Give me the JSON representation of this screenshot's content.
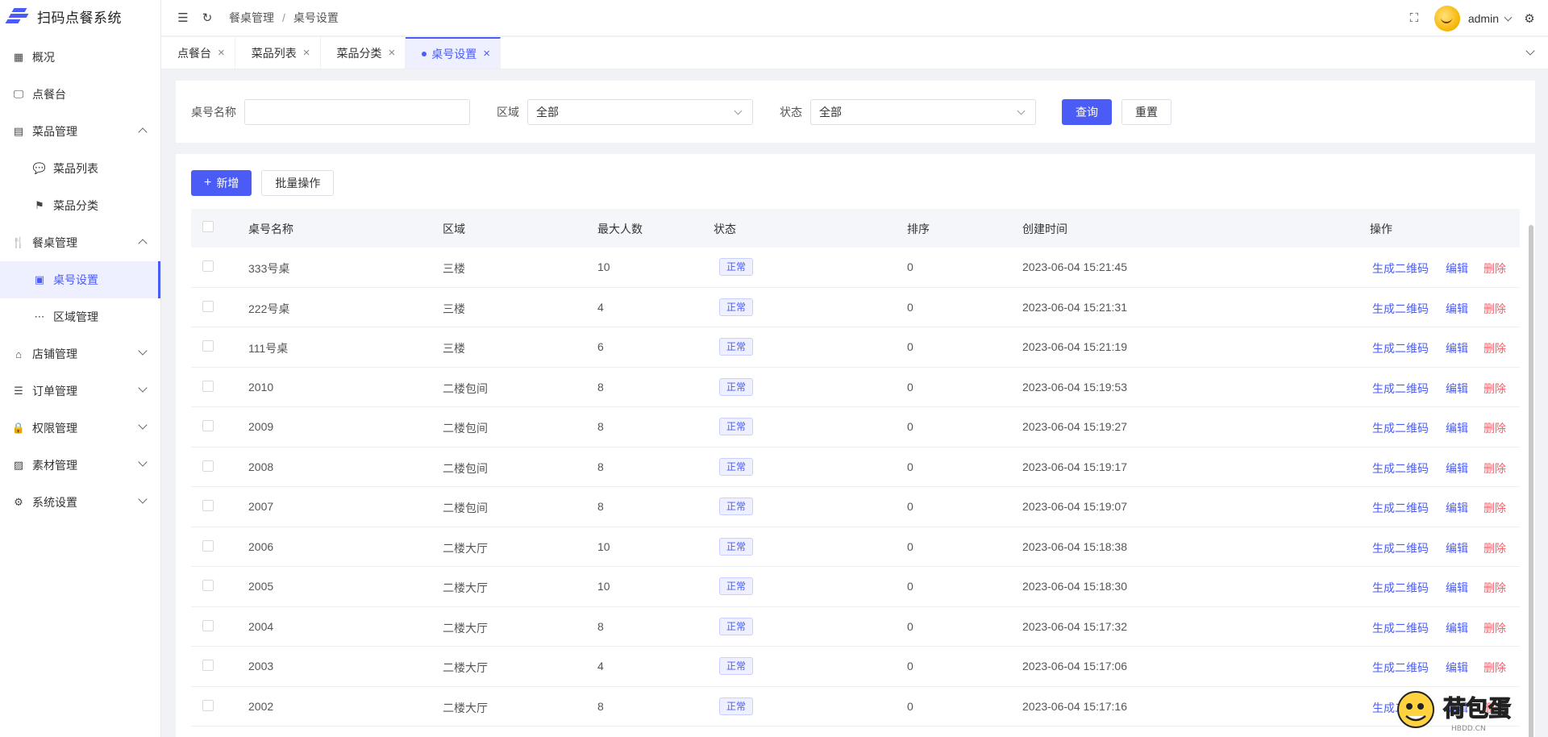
{
  "app": {
    "title": "扫码点餐系统"
  },
  "sidebar": {
    "items": [
      {
        "label": "概况",
        "icon": "dashboard-icon",
        "level": 0
      },
      {
        "label": "点餐台",
        "icon": "monitor-icon",
        "level": 0
      },
      {
        "label": "菜品管理",
        "icon": "message-icon",
        "level": 0,
        "expanded": true
      },
      {
        "label": "菜品列表",
        "icon": "chat-icon",
        "level": 1
      },
      {
        "label": "菜品分类",
        "icon": "bookmark-icon",
        "level": 1
      },
      {
        "label": "餐桌管理",
        "icon": "utensils-icon",
        "level": 0,
        "expanded": true
      },
      {
        "label": "桌号设置",
        "icon": "table-icon",
        "level": 1,
        "active": true
      },
      {
        "label": "区域管理",
        "icon": "dots-icon",
        "level": 1
      },
      {
        "label": "店铺管理",
        "icon": "store-icon",
        "level": 0,
        "expanded": false
      },
      {
        "label": "订单管理",
        "icon": "order-icon",
        "level": 0,
        "expanded": false
      },
      {
        "label": "权限管理",
        "icon": "lock-icon",
        "level": 0,
        "expanded": false
      },
      {
        "label": "素材管理",
        "icon": "image-icon",
        "level": 0,
        "expanded": false
      },
      {
        "label": "系统设置",
        "icon": "gear-icon",
        "level": 0,
        "expanded": false
      }
    ]
  },
  "header": {
    "breadcrumb": [
      "餐桌管理",
      "桌号设置"
    ],
    "user": "admin"
  },
  "tabs": [
    {
      "label": "点餐台",
      "active": false
    },
    {
      "label": "菜品列表",
      "active": false
    },
    {
      "label": "菜品分类",
      "active": false
    },
    {
      "label": "桌号设置",
      "active": true
    }
  ],
  "filters": {
    "name_label": "桌号名称",
    "name_value": "",
    "area_label": "区域",
    "area_value": "全部",
    "status_label": "状态",
    "status_value": "全部",
    "search_button": "查询",
    "reset_button": "重置"
  },
  "toolbar": {
    "add_button": "新增",
    "batch_button": "批量操作"
  },
  "table": {
    "columns": [
      "桌号名称",
      "区域",
      "最大人数",
      "状态",
      "排序",
      "创建时间",
      "操作"
    ],
    "actions": {
      "qr": "生成二维码",
      "edit": "编辑",
      "delete": "删除"
    },
    "rows": [
      {
        "name": "333号桌",
        "area": "三楼",
        "max": "10",
        "status": "正常",
        "sort": "0",
        "created": "2023-06-04 15:21:45"
      },
      {
        "name": "222号桌",
        "area": "三楼",
        "max": "4",
        "status": "正常",
        "sort": "0",
        "created": "2023-06-04 15:21:31"
      },
      {
        "name": "111号桌",
        "area": "三楼",
        "max": "6",
        "status": "正常",
        "sort": "0",
        "created": "2023-06-04 15:21:19"
      },
      {
        "name": "2010",
        "area": "二楼包间",
        "max": "8",
        "status": "正常",
        "sort": "0",
        "created": "2023-06-04 15:19:53"
      },
      {
        "name": "2009",
        "area": "二楼包间",
        "max": "8",
        "status": "正常",
        "sort": "0",
        "created": "2023-06-04 15:19:27"
      },
      {
        "name": "2008",
        "area": "二楼包间",
        "max": "8",
        "status": "正常",
        "sort": "0",
        "created": "2023-06-04 15:19:17"
      },
      {
        "name": "2007",
        "area": "二楼包间",
        "max": "8",
        "status": "正常",
        "sort": "0",
        "created": "2023-06-04 15:19:07"
      },
      {
        "name": "2006",
        "area": "二楼大厅",
        "max": "10",
        "status": "正常",
        "sort": "0",
        "created": "2023-06-04 15:18:38"
      },
      {
        "name": "2005",
        "area": "二楼大厅",
        "max": "10",
        "status": "正常",
        "sort": "0",
        "created": "2023-06-04 15:18:30"
      },
      {
        "name": "2004",
        "area": "二楼大厅",
        "max": "8",
        "status": "正常",
        "sort": "0",
        "created": "2023-06-04 15:17:32"
      },
      {
        "name": "2003",
        "area": "二楼大厅",
        "max": "4",
        "status": "正常",
        "sort": "0",
        "created": "2023-06-04 15:17:06"
      },
      {
        "name": "2002",
        "area": "二楼大厅",
        "max": "8",
        "status": "正常",
        "sort": "0",
        "created": "2023-06-04 15:17:16"
      }
    ]
  },
  "watermark": {
    "text": "荷包蛋",
    "sub": "HBDD.CN"
  },
  "colors": {
    "primary": "#4a5cf5",
    "danger": "#f5606a",
    "active_bg": "#eef0ff"
  }
}
